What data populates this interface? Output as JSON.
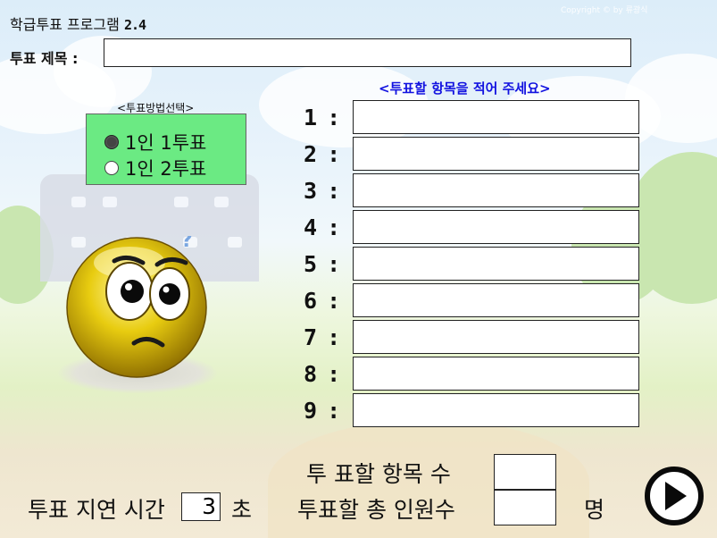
{
  "app": {
    "title": "학급투표 프로그램",
    "version": "2.4",
    "watermark": "Copyright © by 류광식"
  },
  "vote_title": {
    "label": "투표 제목 :",
    "value": ""
  },
  "items_hint": "<투표할 항목을 적어 주세요>",
  "method": {
    "caption": "<투표방법선택>",
    "options": [
      {
        "label": "1인 1투표",
        "selected": true
      },
      {
        "label": "1인 2투표",
        "selected": false
      }
    ]
  },
  "items": [
    {
      "label": "1 :",
      "value": ""
    },
    {
      "label": "2 :",
      "value": ""
    },
    {
      "label": "3 :",
      "value": ""
    },
    {
      "label": "4 :",
      "value": ""
    },
    {
      "label": "5 :",
      "value": ""
    },
    {
      "label": "6 :",
      "value": ""
    },
    {
      "label": "7 :",
      "value": ""
    },
    {
      "label": "8 :",
      "value": ""
    },
    {
      "label": "9 :",
      "value": ""
    }
  ],
  "bottom": {
    "delay_label": "투표 지연 시간",
    "delay_value": "3",
    "delay_unit": "초",
    "item_count_label": "투 표할 항목 수",
    "item_count_value": "",
    "voter_count_label": "투표할  총 인원수",
    "voter_count_value": "",
    "voter_unit": "명"
  },
  "colors": {
    "method_bg": "#6bea83",
    "hint": "#1212e0",
    "face": "#e8cc10"
  },
  "icons": {
    "start": "play-icon",
    "mascot": "confused-smiley-icon"
  }
}
